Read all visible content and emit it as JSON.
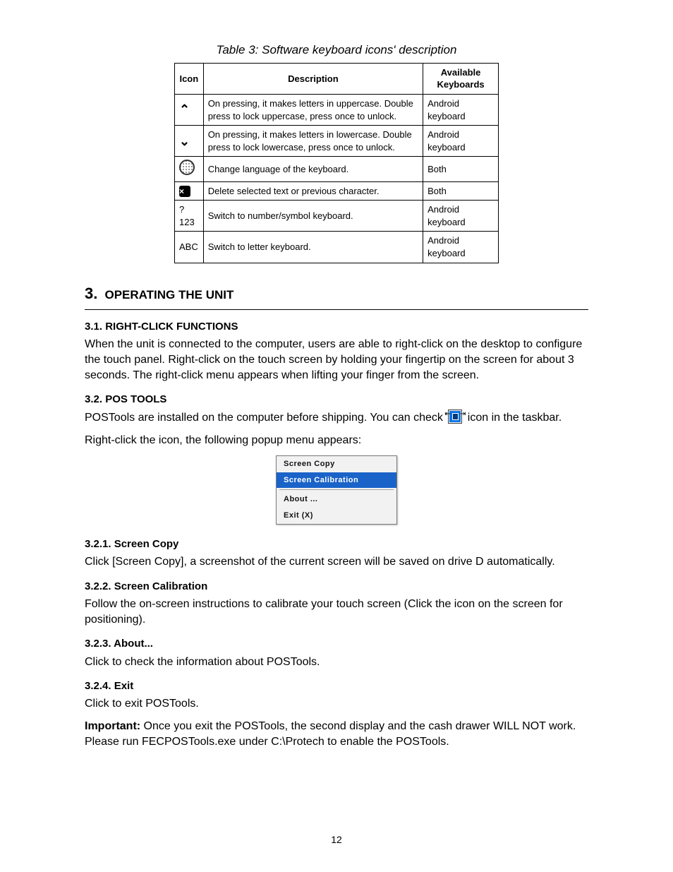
{
  "tableTitle": "Table 3: Software keyboard icons' description",
  "table": {
    "headers": [
      "Icon",
      "Description",
      "Available Keyboards"
    ],
    "rows": [
      {
        "icon": "chev-up",
        "desc": "On pressing, it makes letters in uppercase. Double press to lock uppercase, press once to unlock.",
        "avail": "Android keyboard"
      },
      {
        "icon": "chev-down",
        "desc": "On pressing, it makes letters in lowercase. Double press to lock lowercase, press once to unlock.",
        "avail": "Android keyboard"
      },
      {
        "icon": "dotted-circle",
        "desc": "Change language of the keyboard.",
        "avail": "Both"
      },
      {
        "icon": "close-x",
        "desc": "Delete selected text or previous character.",
        "avail": "Both"
      },
      {
        "icon": "text-123",
        "label": "?123",
        "desc": "Switch to number/symbol keyboard.",
        "avail": "Android keyboard"
      },
      {
        "icon": "text-abc",
        "label": "ABC",
        "desc": "Switch to letter keyboard.",
        "avail": "Android keyboard"
      }
    ]
  },
  "section": {
    "num": "3.",
    "title": "OPERATING THE UNIT"
  },
  "sub_3_1": {
    "num": "3.1.",
    "title": "RIGHT-CLICK FUNCTIONS",
    "body": "When the unit is connected to the computer, users are able to right-click on the desktop to configure the touch panel. Right-click on the touch screen by holding your fingertip on the screen for about 3 seconds. The right-click menu appears when lifting your finger from the screen."
  },
  "sub_3_2": {
    "num": "3.2.",
    "title": "POS TOOLS",
    "intro": "POSTools are installed on the computer before shipping. You can check",
    "introTail": " icon in the taskbar.",
    "rightClick": "Right-click the icon, the following popup menu appears:",
    "popup": {
      "items": [
        "Screen Copy",
        "Screen Calibration"
      ],
      "selectedIndex": 1,
      "subItems": [
        "About ...",
        "Exit (X)"
      ]
    }
  },
  "sub_3_2_1": {
    "num": "3.2.1.",
    "title": "Screen Copy",
    "body": "Click [Screen Copy], a screenshot of the current screen will be saved on drive D automatically."
  },
  "sub_3_2_2": {
    "num": "3.2.2.",
    "title": "Screen Calibration",
    "body": "Follow the on-screen instructions to calibrate your touch screen (Click the icon on the screen for positioning)."
  },
  "sub_3_2_3": {
    "num": "3.2.3.",
    "title": "About...",
    "body": "Click to check the information about POSTools."
  },
  "sub_3_2_4": {
    "num": "3.2.4.",
    "title": "Exit",
    "line1": "Click to exit POSTools.",
    "noteBold": "Important:",
    "note": " Once you exit the POSTools, the second display and the cash drawer WILL NOT work. Please run FECPOSTools.exe under C:\\Protech to enable the POSTools."
  },
  "footer": "12"
}
